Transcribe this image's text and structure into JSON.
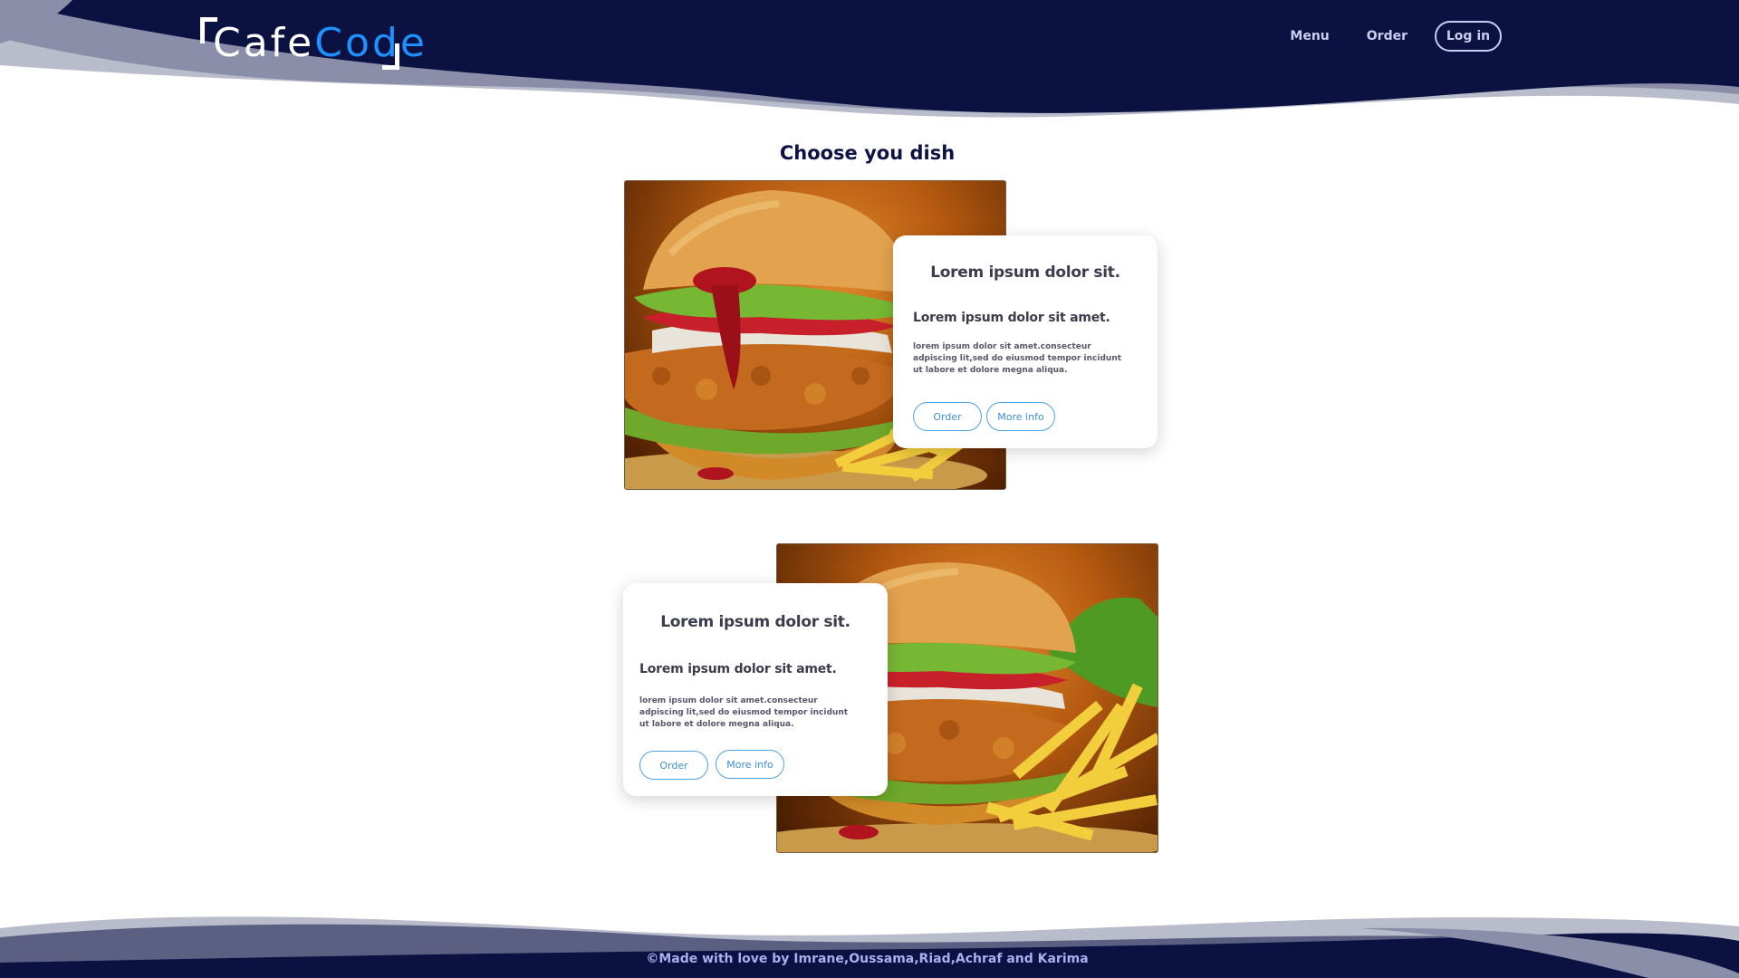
{
  "header": {
    "logo": {
      "part1": "Cafe",
      "part2": "Code"
    },
    "nav": {
      "menu": "Menu",
      "order": "Order",
      "login": "Log in"
    }
  },
  "main": {
    "title": "Choose you dish",
    "dishes": [
      {
        "card_title": "Lorem ipsum dolor sit.",
        "card_subtitle": "Lorem ipsum dolor sit amet.",
        "card_text": "lorem ipsum dolor sit amet.consecteur adpiscing lit,sed do eiusmod tempor incidunt ut labore et dolore megna aliqua.",
        "order_label": "Order",
        "more_info_label": "More info",
        "image": "burger-with-fries"
      },
      {
        "card_title": "Lorem ipsum dolor sit.",
        "card_subtitle": "Lorem ipsum dolor sit amet.",
        "card_text": "lorem ipsum dolor sit amet.consecteur adpiscing lit,sed do eiusmod tempor incidunt ut labore et dolore megna aliqua.",
        "order_label": "Order",
        "more_info_label": "More info",
        "image": "burger-with-fries"
      }
    ]
  },
  "footer": {
    "text": "©Made with love by  Imrane,Oussama,Riad,Achraf and Karima"
  },
  "colors": {
    "navy": "#0b1140",
    "wave_light": "#8a8ea8",
    "wave_lighter": "#b9bccb",
    "accent_blue": "#1e90ff",
    "nav_text": "#c9cdf0",
    "button_border": "#4aa3e6"
  }
}
